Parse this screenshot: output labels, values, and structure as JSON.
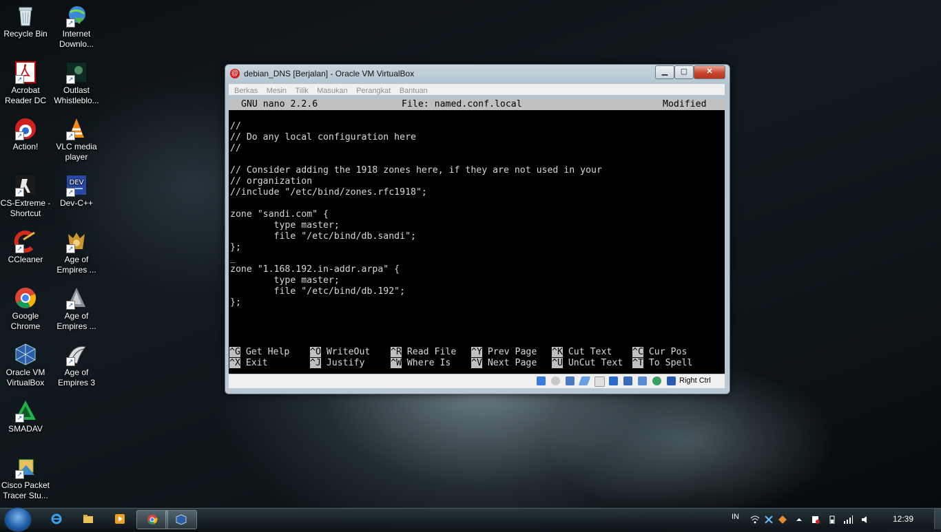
{
  "desktop": {
    "icons": [
      {
        "label_line1": "Recycle Bin",
        "label_line2": "",
        "icon": "recycle-bin-icon"
      },
      {
        "label_line1": "Internet",
        "label_line2": "Downlo...",
        "icon": "internet-download-manager-icon"
      },
      {
        "label_line1": "Acrobat",
        "label_line2": "Reader DC",
        "icon": "acrobat-reader-icon"
      },
      {
        "label_line1": "Outlast",
        "label_line2": "Whistleblo...",
        "icon": "outlast-icon"
      },
      {
        "label_line1": "Action!",
        "label_line2": "",
        "icon": "action-icon"
      },
      {
        "label_line1": "VLC media",
        "label_line2": "player",
        "icon": "vlc-icon"
      },
      {
        "label_line1": "CS-Extreme -",
        "label_line2": "Shortcut",
        "icon": "cs-extreme-icon"
      },
      {
        "label_line1": "Dev-C++",
        "label_line2": "",
        "icon": "dev-cpp-icon"
      },
      {
        "label_line1": "CCleaner",
        "label_line2": "",
        "icon": "ccleaner-icon"
      },
      {
        "label_line1": "Age of",
        "label_line2": "Empires ...",
        "icon": "age-of-empires-icon"
      },
      {
        "label_line1": "Google",
        "label_line2": "Chrome",
        "icon": "chrome-icon"
      },
      {
        "label_line1": "Age of",
        "label_line2": "Empires ...",
        "icon": "age-of-empires-icon"
      },
      {
        "label_line1": "Oracle VM",
        "label_line2": "VirtualBox",
        "icon": "virtualbox-icon"
      },
      {
        "label_line1": "Age of",
        "label_line2": "Empires 3",
        "icon": "age-of-empires-3-icon"
      },
      {
        "label_line1": "SMADAV",
        "label_line2": "",
        "icon": "smadav-icon"
      },
      {
        "label_line1": "Cisco Packet",
        "label_line2": "Tracer Stu...",
        "icon": "cisco-packet-tracer-icon"
      }
    ]
  },
  "window": {
    "title": "debian_DNS [Berjalan] - Oracle VM VirtualBox",
    "minimize_glyph": "▁",
    "maximize_glyph": "▢",
    "close_glyph": "✕",
    "menu": [
      "Berkas",
      "Mesin",
      "Tilik",
      "Masukan",
      "Perangkat",
      "Bantuan"
    ],
    "host_key": "Right Ctrl"
  },
  "nano": {
    "version": "GNU nano 2.2.6",
    "file": "File: named.conf.local",
    "state": "Modified",
    "lines": [
      "//",
      "// Do any local configuration here",
      "//",
      "",
      "// Consider adding the 1918 zones here, if they are not used in your",
      "// organization",
      "//include \"/etc/bind/zones.rfc1918\";",
      "",
      "zone \"sandi.com\" {",
      "        type master;",
      "        file \"/etc/bind/db.sandi\";",
      "};",
      "_",
      "zone \"1.168.192.in-addr.arpa\" {",
      "        type master;",
      "        file \"/etc/bind/db.192\";",
      "};"
    ],
    "shortcuts_row1": [
      {
        "key": "^G",
        "label": "Get Help"
      },
      {
        "key": "^O",
        "label": "WriteOut"
      },
      {
        "key": "^R",
        "label": "Read File"
      },
      {
        "key": "^Y",
        "label": "Prev Page"
      },
      {
        "key": "^K",
        "label": "Cut Text"
      },
      {
        "key": "^C",
        "label": "Cur Pos"
      }
    ],
    "shortcuts_row2": [
      {
        "key": "^X",
        "label": "Exit"
      },
      {
        "key": "^J",
        "label": "Justify"
      },
      {
        "key": "^W",
        "label": "Where Is"
      },
      {
        "key": "^V",
        "label": "Next Page"
      },
      {
        "key": "^U",
        "label": "UnCut Text"
      },
      {
        "key": "^T",
        "label": "To Spell"
      }
    ]
  },
  "taskbar": {
    "apps": [
      "internet-explorer-icon",
      "folder-icon",
      "media-player-icon",
      "chrome-icon",
      "virtualbox-icon"
    ],
    "language": "IN",
    "clock": "12:39"
  },
  "colors": {
    "terminal_bg": "#000000",
    "terminal_fg": "#d8d8d8",
    "nano_bar": "#c0c0c0",
    "close_red": "#c7442c"
  }
}
